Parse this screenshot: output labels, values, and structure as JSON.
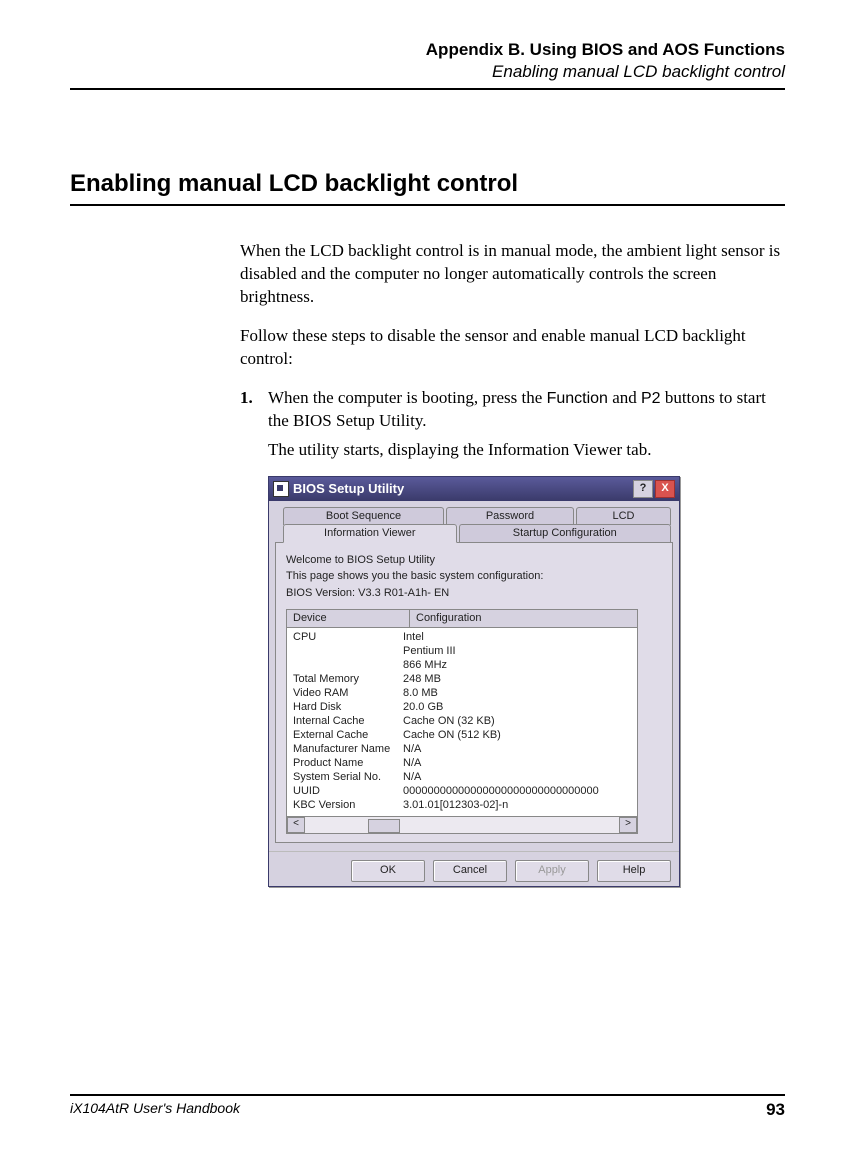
{
  "header": {
    "title": "Appendix B. Using BIOS and AOS Functions",
    "subtitle": "Enabling manual LCD backlight control"
  },
  "section": {
    "title": "Enabling manual LCD backlight control",
    "para1": "When the LCD backlight control is in manual mode, the ambient light sensor is disabled and the computer no longer automatically controls the screen brightness.",
    "para2": "Follow these steps to disable the sensor and enable manual LCD backlight control:",
    "step1_num": "1.",
    "step1a_pre": "When the computer is booting, press the ",
    "step1a_fn": "Function",
    "step1a_mid": " and ",
    "step1a_p2": "P2",
    "step1a_post": " buttons to start the BIOS Setup Utility.",
    "step1b": "The utility starts, displaying the Information Viewer tab."
  },
  "bios": {
    "title": "BIOS Setup Utility",
    "help_btn": "?",
    "close_btn": "X",
    "tabs": {
      "boot": "Boot Sequence",
      "password": "Password",
      "lcd": "LCD",
      "info": "Information Viewer",
      "startup": "Startup Configuration"
    },
    "welcome": "Welcome to BIOS Setup Utility",
    "desc": "This page shows you the basic system configuration:",
    "version_label": "BIOS Version: V3.3 R01-A1h- EN",
    "table": {
      "col_device": "Device",
      "col_config": "Configuration",
      "rows": [
        {
          "dev": "CPU",
          "cfg": "Intel"
        },
        {
          "dev": "",
          "cfg": "Pentium III"
        },
        {
          "dev": "",
          "cfg": "866 MHz"
        },
        {
          "dev": "Total Memory",
          "cfg": "248 MB"
        },
        {
          "dev": "Video RAM",
          "cfg": "8.0 MB"
        },
        {
          "dev": "Hard Disk",
          "cfg": "20.0 GB"
        },
        {
          "dev": "Internal Cache",
          "cfg": "Cache ON (32 KB)"
        },
        {
          "dev": "External Cache",
          "cfg": "Cache ON (512 KB)"
        },
        {
          "dev": "Manufacturer Name",
          "cfg": "N/A"
        },
        {
          "dev": "Product Name",
          "cfg": "N/A"
        },
        {
          "dev": "System Serial No.",
          "cfg": "N/A"
        },
        {
          "dev": "UUID",
          "cfg": "00000000000000000000000000000000"
        },
        {
          "dev": "KBC Version",
          "cfg": "3.01.01[012303-02]-n"
        }
      ]
    },
    "scroll_left": "<",
    "scroll_right": ">",
    "buttons": {
      "ok": "OK",
      "cancel": "Cancel",
      "apply": "Apply",
      "help": "Help"
    }
  },
  "footer": {
    "book": "iX104AtR User's Handbook",
    "page": "93"
  }
}
